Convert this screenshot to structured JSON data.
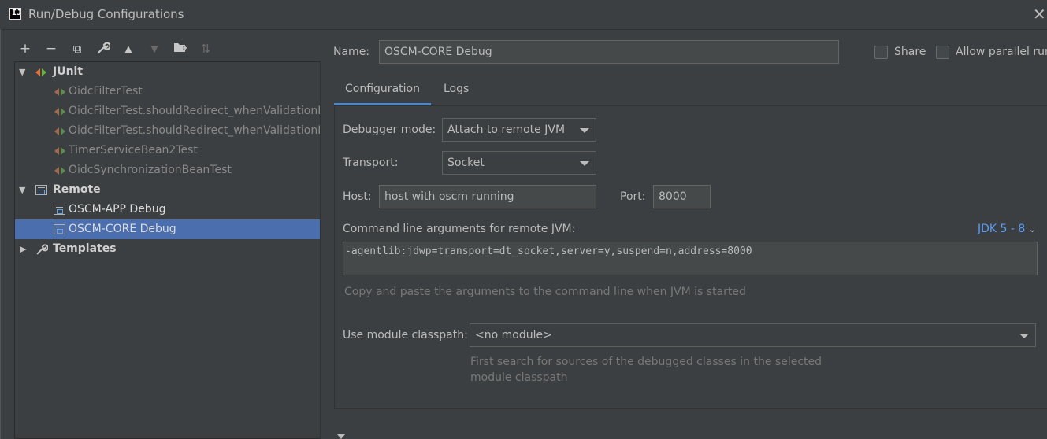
{
  "window": {
    "title": "Run/Debug Configurations",
    "close_glyph": "✕",
    "app_icon_letter": "IJ"
  },
  "toolbar": [
    {
      "name": "add-icon",
      "glyph": "+",
      "enabled": true
    },
    {
      "name": "remove-icon",
      "glyph": "−",
      "enabled": true
    },
    {
      "name": "copy-icon",
      "glyph": "⧉",
      "enabled": true
    },
    {
      "name": "wrench-icon",
      "glyph": "🔧",
      "enabled": true
    },
    {
      "name": "move-up-icon",
      "glyph": "▲",
      "enabled": true
    },
    {
      "name": "move-down-icon",
      "glyph": "▼",
      "enabled": false
    },
    {
      "name": "new-folder-icon",
      "glyph": "🗀",
      "enabled": true
    },
    {
      "name": "sort-icon",
      "glyph": "⇅",
      "enabled": false
    }
  ],
  "tree": {
    "junit": {
      "label": "JUnit",
      "items": [
        "OidcFilterTest",
        "OidcFilterTest.shouldRedirect_whenValidationFailed",
        "OidcFilterTest.shouldRedirect_whenValidationFailed",
        "TimerServiceBean2Test",
        "OidcSynchronizationBeanTest"
      ]
    },
    "remote": {
      "label": "Remote",
      "items": [
        "OSCM-APP Debug",
        "OSCM-CORE Debug"
      ]
    },
    "templates": {
      "label": "Templates"
    }
  },
  "config": {
    "name_label": "Name:",
    "name_value": "OSCM-CORE Debug",
    "share_label": "Share",
    "parallel_label": "Allow parallel run",
    "share_checked": false,
    "parallel_checked": false,
    "tabs": [
      "Configuration",
      "Logs"
    ],
    "debugger_mode_label": "Debugger mode:",
    "debugger_mode_value": "Attach to remote JVM",
    "transport_label": "Transport:",
    "transport_value": "Socket",
    "host_label": "Host:",
    "host_value": "host with oscm running",
    "port_label": "Port:",
    "port_value": "8000",
    "cmd_label": "Command line arguments for remote JVM:",
    "jdk_link": "JDK 5 - 8",
    "cmd_value": "-agentlib:jdwp=transport=dt_socket,server=y,suspend=n,address=8000",
    "cmd_hint": "Copy and paste the arguments to the command line when JVM is started",
    "module_label": "Use module classpath:",
    "module_value": "<no module>",
    "module_hint_1": "First search for sources of the debugged classes in the selected",
    "module_hint_2": "module classpath"
  }
}
